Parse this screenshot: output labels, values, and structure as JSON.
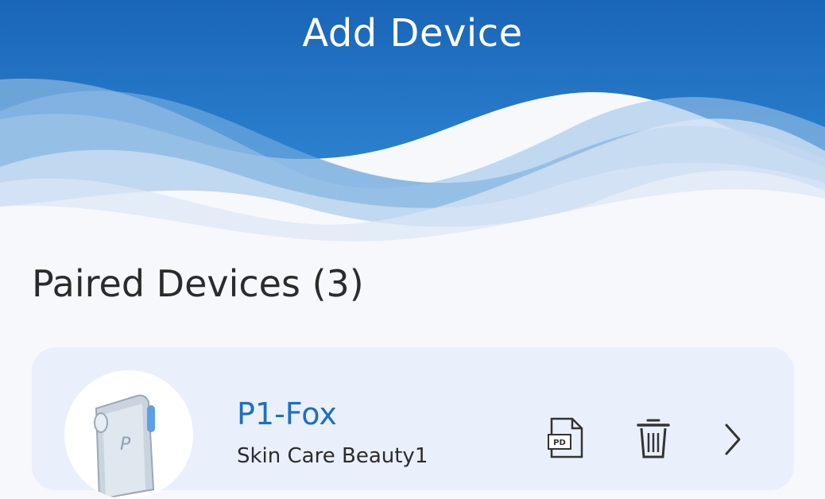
{
  "header": {
    "title": "Add Device"
  },
  "paired": {
    "title": "Paired Devices (3)"
  },
  "devices": [
    {
      "name": "P1-Fox",
      "subtitle": "Skin Care Beauty1",
      "icons": [
        "pdf-icon",
        "trash-icon",
        "chevron-right-icon"
      ],
      "device_logo": "P"
    }
  ],
  "colors": {
    "header_blue": "#1c6dbc",
    "name_blue": "#1e6fbf",
    "card_bg": "#eaf0fb"
  }
}
